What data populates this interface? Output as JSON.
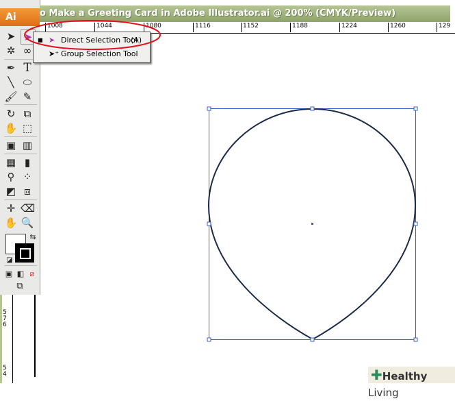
{
  "window": {
    "title": "o Make a Greeting Card in Adobe Illustrator.ai @ 200% (CMYK/Preview)"
  },
  "app": {
    "logo": "Ai"
  },
  "ruler": {
    "labels": [
      "1008",
      "1044",
      "1080",
      "1116",
      "1152",
      "1188",
      "1224",
      "1260",
      "129"
    ]
  },
  "vruler": {
    "labels": [
      "5",
      "7",
      "6",
      "5",
      "4"
    ]
  },
  "menu": {
    "items": [
      {
        "label": "Direct Selection Tool",
        "shortcut": "(A)",
        "selected": true
      },
      {
        "label": "Group Selection Tool",
        "shortcut": ""
      }
    ]
  },
  "highlight_color": "#e0141e",
  "selection_color": "#3a5fc8",
  "brand": {
    "bold": "Healthy",
    "light": " Living"
  }
}
